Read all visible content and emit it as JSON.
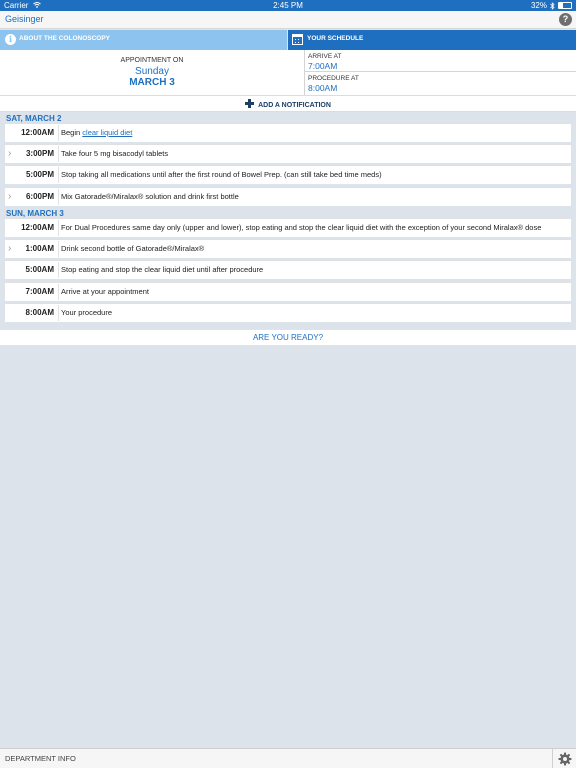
{
  "status_bar": {
    "carrier": "Carrier",
    "wifi_icon": "wifi-icon",
    "time": "2:45 PM",
    "battery_percent": "32%",
    "battery_level": 0.32,
    "bluetooth_icon": "bluetooth-icon"
  },
  "navbar": {
    "back_label": "Geisinger",
    "help_label": "?",
    "help_icon": "help-icon"
  },
  "about": {
    "label": "ABOUT THE COLONOSCOPY",
    "icon": "info-icon"
  },
  "appointment": {
    "label": "APPOINTMENT ON",
    "day": "Sunday",
    "date": "MARCH 3"
  },
  "schedule": {
    "label": "YOUR SCHEDULE",
    "icon": "calendar-icon",
    "arrive_label": "ARRIVE AT",
    "arrive_time": "7:00AM",
    "procedure_label": "PROCEDURE AT",
    "procedure_time": "8:00AM"
  },
  "notification": {
    "label": "ADD A NOTIFICATION",
    "icon": "plus-icon"
  },
  "days": [
    {
      "header": "SAT, MARCH 2",
      "items": [
        {
          "time": "12:00AM",
          "text": "Begin ",
          "link": "clear liquid diet",
          "chevron": false
        },
        {
          "time": "3:00PM",
          "text": "Take four 5 mg bisacodyl tablets",
          "chevron": true
        },
        {
          "time": "5:00PM",
          "text": "Stop taking all medications until after the first round of Bowel Prep. (can still take bed time meds)",
          "chevron": false
        },
        {
          "time": "6:00PM",
          "text": "Mix Gatorade®/Miralax® solution and drink first bottle",
          "chevron": true
        }
      ]
    },
    {
      "header": "SUN, MARCH 3",
      "items": [
        {
          "time": "12:00AM",
          "text": "For Dual Procedures same day only (upper and lower), stop eating and stop the clear liquid diet with the exception of your second Miralax® dose",
          "chevron": false
        },
        {
          "time": "1:00AM",
          "text": "Drink second bottle of Gatorade®/Miralax®",
          "chevron": true
        },
        {
          "time": "5:00AM",
          "text": "Stop eating and stop the clear liquid diet until after procedure",
          "chevron": false
        },
        {
          "time": "7:00AM",
          "text": "Arrive at your appointment",
          "chevron": false
        },
        {
          "time": "8:00AM",
          "text": "Your procedure",
          "chevron": false
        }
      ]
    }
  ],
  "chevron_glyph": "›",
  "ready_label": "ARE YOU READY?",
  "bottom_bar": {
    "label": "DEPARTMENT INFO",
    "settings_icon": "gear-icon"
  },
  "colors": {
    "accent_blue": "#1f6fc1",
    "light_blue": "#8cc4ef",
    "background": "#dde3ea"
  }
}
